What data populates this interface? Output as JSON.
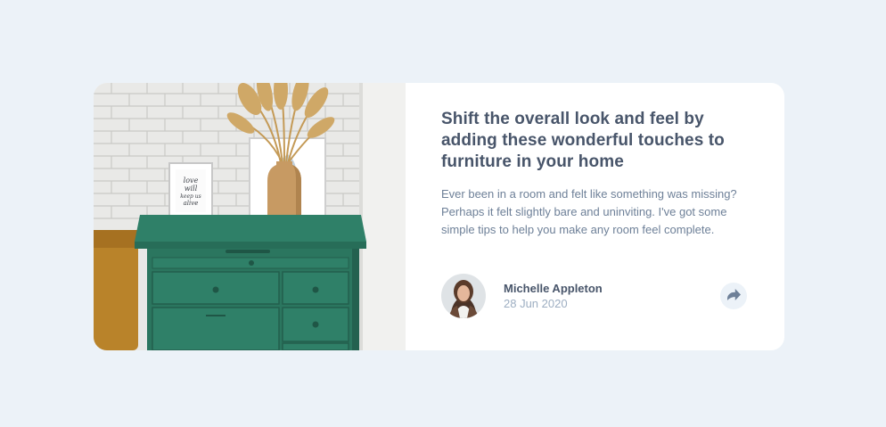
{
  "article": {
    "image_alt": "Green drawer with a vase of dried grass and framed prints against a white brick wall",
    "frame_text": [
      "love",
      "will",
      "keep us",
      "alive"
    ],
    "headline": "Shift the overall look and feel by adding these wonderful touches to furniture in your home",
    "excerpt": "Ever been in a room and felt like something was missing? Perhaps it felt slightly bare and uninviting. I've got some simple tips to help you make any room feel complete.",
    "author": {
      "name": "Michelle Appleton",
      "date": "28 Jun 2020"
    },
    "share_icon": "share-arrow-icon"
  },
  "colors": {
    "page_background": "#ECF2F8",
    "card_background": "#FFFFFF",
    "headline": "#48556A",
    "body_text": "#6E8098",
    "muted_text": "#9DAEC2",
    "drawer_green": "#2E7B63"
  }
}
